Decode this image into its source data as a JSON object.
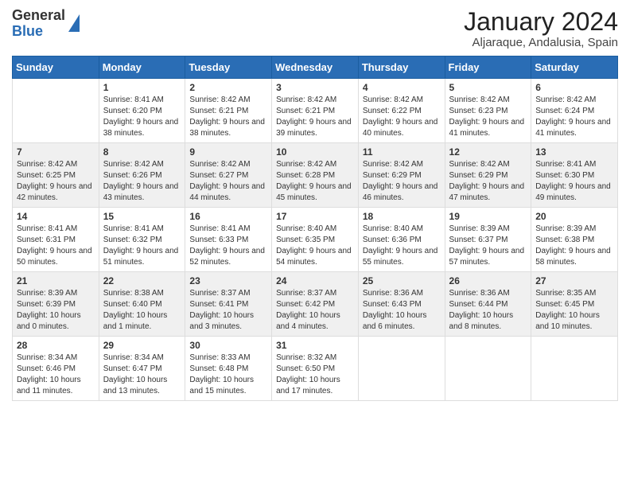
{
  "header": {
    "logo_general": "General",
    "logo_blue": "Blue",
    "title": "January 2024",
    "subtitle": "Aljaraque, Andalusia, Spain"
  },
  "weekdays": [
    "Sunday",
    "Monday",
    "Tuesday",
    "Wednesday",
    "Thursday",
    "Friday",
    "Saturday"
  ],
  "weeks": [
    [
      {
        "day": "",
        "sunrise": "",
        "sunset": "",
        "daylight": ""
      },
      {
        "day": "1",
        "sunrise": "Sunrise: 8:41 AM",
        "sunset": "Sunset: 6:20 PM",
        "daylight": "Daylight: 9 hours and 38 minutes."
      },
      {
        "day": "2",
        "sunrise": "Sunrise: 8:42 AM",
        "sunset": "Sunset: 6:21 PM",
        "daylight": "Daylight: 9 hours and 38 minutes."
      },
      {
        "day": "3",
        "sunrise": "Sunrise: 8:42 AM",
        "sunset": "Sunset: 6:21 PM",
        "daylight": "Daylight: 9 hours and 39 minutes."
      },
      {
        "day": "4",
        "sunrise": "Sunrise: 8:42 AM",
        "sunset": "Sunset: 6:22 PM",
        "daylight": "Daylight: 9 hours and 40 minutes."
      },
      {
        "day": "5",
        "sunrise": "Sunrise: 8:42 AM",
        "sunset": "Sunset: 6:23 PM",
        "daylight": "Daylight: 9 hours and 41 minutes."
      },
      {
        "day": "6",
        "sunrise": "Sunrise: 8:42 AM",
        "sunset": "Sunset: 6:24 PM",
        "daylight": "Daylight: 9 hours and 41 minutes."
      }
    ],
    [
      {
        "day": "7",
        "sunrise": "Sunrise: 8:42 AM",
        "sunset": "Sunset: 6:25 PM",
        "daylight": "Daylight: 9 hours and 42 minutes."
      },
      {
        "day": "8",
        "sunrise": "Sunrise: 8:42 AM",
        "sunset": "Sunset: 6:26 PM",
        "daylight": "Daylight: 9 hours and 43 minutes."
      },
      {
        "day": "9",
        "sunrise": "Sunrise: 8:42 AM",
        "sunset": "Sunset: 6:27 PM",
        "daylight": "Daylight: 9 hours and 44 minutes."
      },
      {
        "day": "10",
        "sunrise": "Sunrise: 8:42 AM",
        "sunset": "Sunset: 6:28 PM",
        "daylight": "Daylight: 9 hours and 45 minutes."
      },
      {
        "day": "11",
        "sunrise": "Sunrise: 8:42 AM",
        "sunset": "Sunset: 6:29 PM",
        "daylight": "Daylight: 9 hours and 46 minutes."
      },
      {
        "day": "12",
        "sunrise": "Sunrise: 8:42 AM",
        "sunset": "Sunset: 6:29 PM",
        "daylight": "Daylight: 9 hours and 47 minutes."
      },
      {
        "day": "13",
        "sunrise": "Sunrise: 8:41 AM",
        "sunset": "Sunset: 6:30 PM",
        "daylight": "Daylight: 9 hours and 49 minutes."
      }
    ],
    [
      {
        "day": "14",
        "sunrise": "Sunrise: 8:41 AM",
        "sunset": "Sunset: 6:31 PM",
        "daylight": "Daylight: 9 hours and 50 minutes."
      },
      {
        "day": "15",
        "sunrise": "Sunrise: 8:41 AM",
        "sunset": "Sunset: 6:32 PM",
        "daylight": "Daylight: 9 hours and 51 minutes."
      },
      {
        "day": "16",
        "sunrise": "Sunrise: 8:41 AM",
        "sunset": "Sunset: 6:33 PM",
        "daylight": "Daylight: 9 hours and 52 minutes."
      },
      {
        "day": "17",
        "sunrise": "Sunrise: 8:40 AM",
        "sunset": "Sunset: 6:35 PM",
        "daylight": "Daylight: 9 hours and 54 minutes."
      },
      {
        "day": "18",
        "sunrise": "Sunrise: 8:40 AM",
        "sunset": "Sunset: 6:36 PM",
        "daylight": "Daylight: 9 hours and 55 minutes."
      },
      {
        "day": "19",
        "sunrise": "Sunrise: 8:39 AM",
        "sunset": "Sunset: 6:37 PM",
        "daylight": "Daylight: 9 hours and 57 minutes."
      },
      {
        "day": "20",
        "sunrise": "Sunrise: 8:39 AM",
        "sunset": "Sunset: 6:38 PM",
        "daylight": "Daylight: 9 hours and 58 minutes."
      }
    ],
    [
      {
        "day": "21",
        "sunrise": "Sunrise: 8:39 AM",
        "sunset": "Sunset: 6:39 PM",
        "daylight": "Daylight: 10 hours and 0 minutes."
      },
      {
        "day": "22",
        "sunrise": "Sunrise: 8:38 AM",
        "sunset": "Sunset: 6:40 PM",
        "daylight": "Daylight: 10 hours and 1 minute."
      },
      {
        "day": "23",
        "sunrise": "Sunrise: 8:37 AM",
        "sunset": "Sunset: 6:41 PM",
        "daylight": "Daylight: 10 hours and 3 minutes."
      },
      {
        "day": "24",
        "sunrise": "Sunrise: 8:37 AM",
        "sunset": "Sunset: 6:42 PM",
        "daylight": "Daylight: 10 hours and 4 minutes."
      },
      {
        "day": "25",
        "sunrise": "Sunrise: 8:36 AM",
        "sunset": "Sunset: 6:43 PM",
        "daylight": "Daylight: 10 hours and 6 minutes."
      },
      {
        "day": "26",
        "sunrise": "Sunrise: 8:36 AM",
        "sunset": "Sunset: 6:44 PM",
        "daylight": "Daylight: 10 hours and 8 minutes."
      },
      {
        "day": "27",
        "sunrise": "Sunrise: 8:35 AM",
        "sunset": "Sunset: 6:45 PM",
        "daylight": "Daylight: 10 hours and 10 minutes."
      }
    ],
    [
      {
        "day": "28",
        "sunrise": "Sunrise: 8:34 AM",
        "sunset": "Sunset: 6:46 PM",
        "daylight": "Daylight: 10 hours and 11 minutes."
      },
      {
        "day": "29",
        "sunrise": "Sunrise: 8:34 AM",
        "sunset": "Sunset: 6:47 PM",
        "daylight": "Daylight: 10 hours and 13 minutes."
      },
      {
        "day": "30",
        "sunrise": "Sunrise: 8:33 AM",
        "sunset": "Sunset: 6:48 PM",
        "daylight": "Daylight: 10 hours and 15 minutes."
      },
      {
        "day": "31",
        "sunrise": "Sunrise: 8:32 AM",
        "sunset": "Sunset: 6:50 PM",
        "daylight": "Daylight: 10 hours and 17 minutes."
      },
      {
        "day": "",
        "sunrise": "",
        "sunset": "",
        "daylight": ""
      },
      {
        "day": "",
        "sunrise": "",
        "sunset": "",
        "daylight": ""
      },
      {
        "day": "",
        "sunrise": "",
        "sunset": "",
        "daylight": ""
      }
    ]
  ]
}
